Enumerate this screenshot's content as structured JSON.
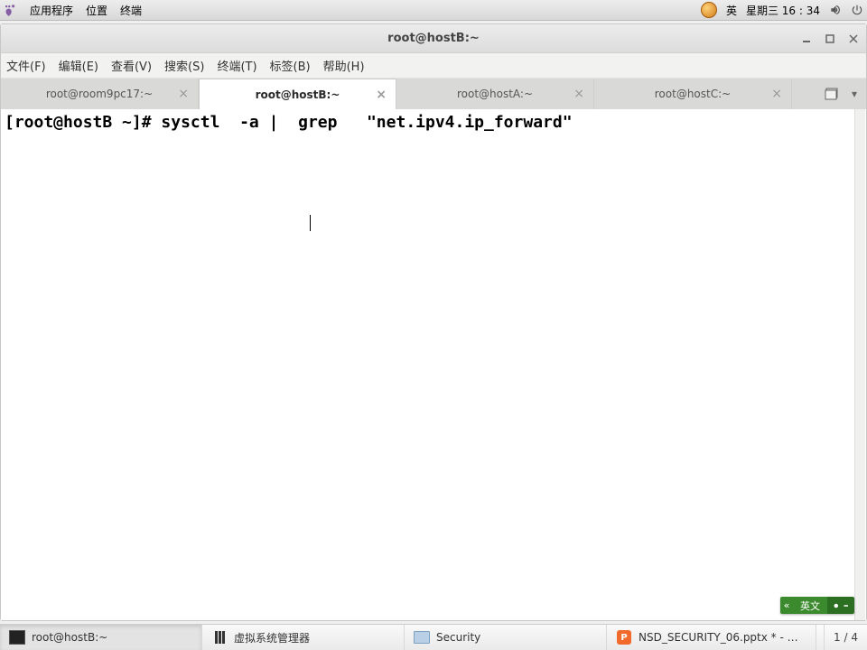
{
  "topbar": {
    "apps": "应用程序",
    "places": "位置",
    "terminal": "终端",
    "ime": "英",
    "datetime": "星期三 16 : 34"
  },
  "window": {
    "title": "root@hostB:~"
  },
  "menu": {
    "file": "文件(F)",
    "edit": "编辑(E)",
    "view": "查看(V)",
    "search": "搜索(S)",
    "terminal": "终端(T)",
    "tabs": "标签(B)",
    "help": "帮助(H)"
  },
  "tabs": [
    {
      "label": "root@room9pc17:~",
      "active": false
    },
    {
      "label": "root@hostB:~",
      "active": true
    },
    {
      "label": "root@hostA:~",
      "active": false
    },
    {
      "label": "root@hostC:~",
      "active": false
    }
  ],
  "terminal": {
    "line1": "[root@hostB ~]# sysctl  -a |  grep   \"net.ipv4.ip_forward\""
  },
  "ime_pill": {
    "lang": "英文"
  },
  "taskbar": {
    "items": [
      {
        "label": "root@hostB:~",
        "icon": "terminal"
      },
      {
        "label": "虚拟系统管理器",
        "icon": "vmm"
      },
      {
        "label": "Security",
        "icon": "folder"
      },
      {
        "label": "NSD_SECURITY_06.pptx * - W…",
        "icon": "ppt"
      }
    ],
    "pager": "1 / 4"
  }
}
